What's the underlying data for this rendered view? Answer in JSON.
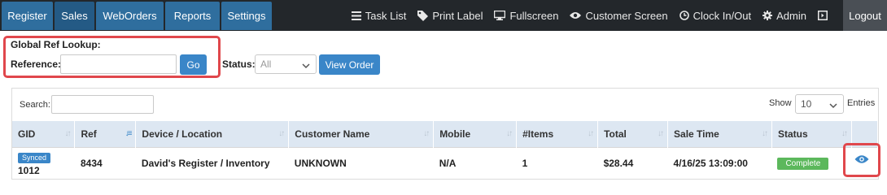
{
  "nav": {
    "tabs": [
      "Register",
      "Sales",
      "WebOrders",
      "Reports",
      "Settings"
    ],
    "active_tab": "Sales",
    "links": {
      "task_list": "Task List",
      "print_label": "Print Label",
      "fullscreen": "Fullscreen",
      "customer_screen": "Customer Screen",
      "clock": "Clock In/Out",
      "admin": "Admin"
    },
    "logout": "Logout"
  },
  "lookup": {
    "title": "Global Ref Lookup:",
    "reference_label": "Reference:",
    "reference_value": "",
    "go_label": "Go",
    "status_label": "Status:",
    "status_value": "All",
    "view_order_label": "View Order"
  },
  "table_controls": {
    "search_label": "Search:",
    "search_value": "",
    "show_label": "Show",
    "show_value": "10",
    "entries_label": "Entries"
  },
  "table": {
    "columns": [
      "GID",
      "Ref",
      "Device / Location",
      "Customer Name",
      "Mobile",
      "#Items",
      "Total",
      "Sale Time",
      "Status"
    ],
    "rows": [
      {
        "gid_badge": "Synced",
        "gid": "1012",
        "ref": "8434",
        "device_location": "David's Register / Inventory",
        "customer_name": "UNKNOWN",
        "mobile": "N/A",
        "items": "1",
        "total": "$28.44",
        "sale_time": "4/16/25 13:09:00",
        "status": "Complete"
      }
    ]
  },
  "colors": {
    "nav_bg": "#23272b",
    "tab_bg": "#2f6e9e",
    "accent": "#3a86c8",
    "highlight": "#e0474c",
    "status_complete": "#5cb85c",
    "header_bg": "#dde7f2"
  }
}
